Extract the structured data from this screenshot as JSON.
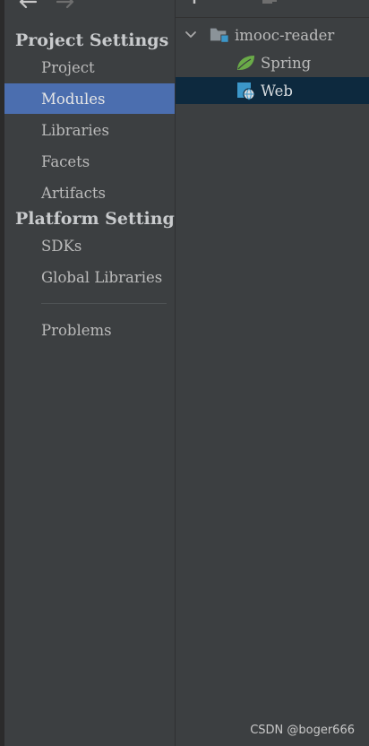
{
  "colors": {
    "background": "#3c3f41",
    "selection": "#4b6eaf",
    "tree_selection": "#0d293e",
    "text": "#bbbbbb",
    "folder_blue": "#3c97c9",
    "spring_green": "#6aab48"
  },
  "toolbar": {
    "back_icon": "arrow-left-icon",
    "forward_icon": "arrow-right-icon",
    "add_icon": "plus-icon",
    "remove_icon": "minus-icon",
    "copy_icon": "copy-icon"
  },
  "sidebar": {
    "project_settings_title": "Project Settings",
    "project_items": [
      {
        "label": "Project"
      },
      {
        "label": "Modules"
      },
      {
        "label": "Libraries"
      },
      {
        "label": "Facets"
      },
      {
        "label": "Artifacts"
      }
    ],
    "platform_settings_title": "Platform Settings",
    "platform_items": [
      {
        "label": "SDKs"
      },
      {
        "label": "Global Libraries"
      }
    ],
    "problems_label": "Problems",
    "selected": "Modules"
  },
  "tree": {
    "module": {
      "label": "imooc-reader",
      "expanded": true,
      "icon": "module-folder-icon"
    },
    "children": [
      {
        "label": "Spring",
        "icon": "spring-leaf-icon"
      },
      {
        "label": "Web",
        "icon": "web-facet-icon",
        "selected": true
      }
    ]
  },
  "watermark": "CSDN @boger666"
}
